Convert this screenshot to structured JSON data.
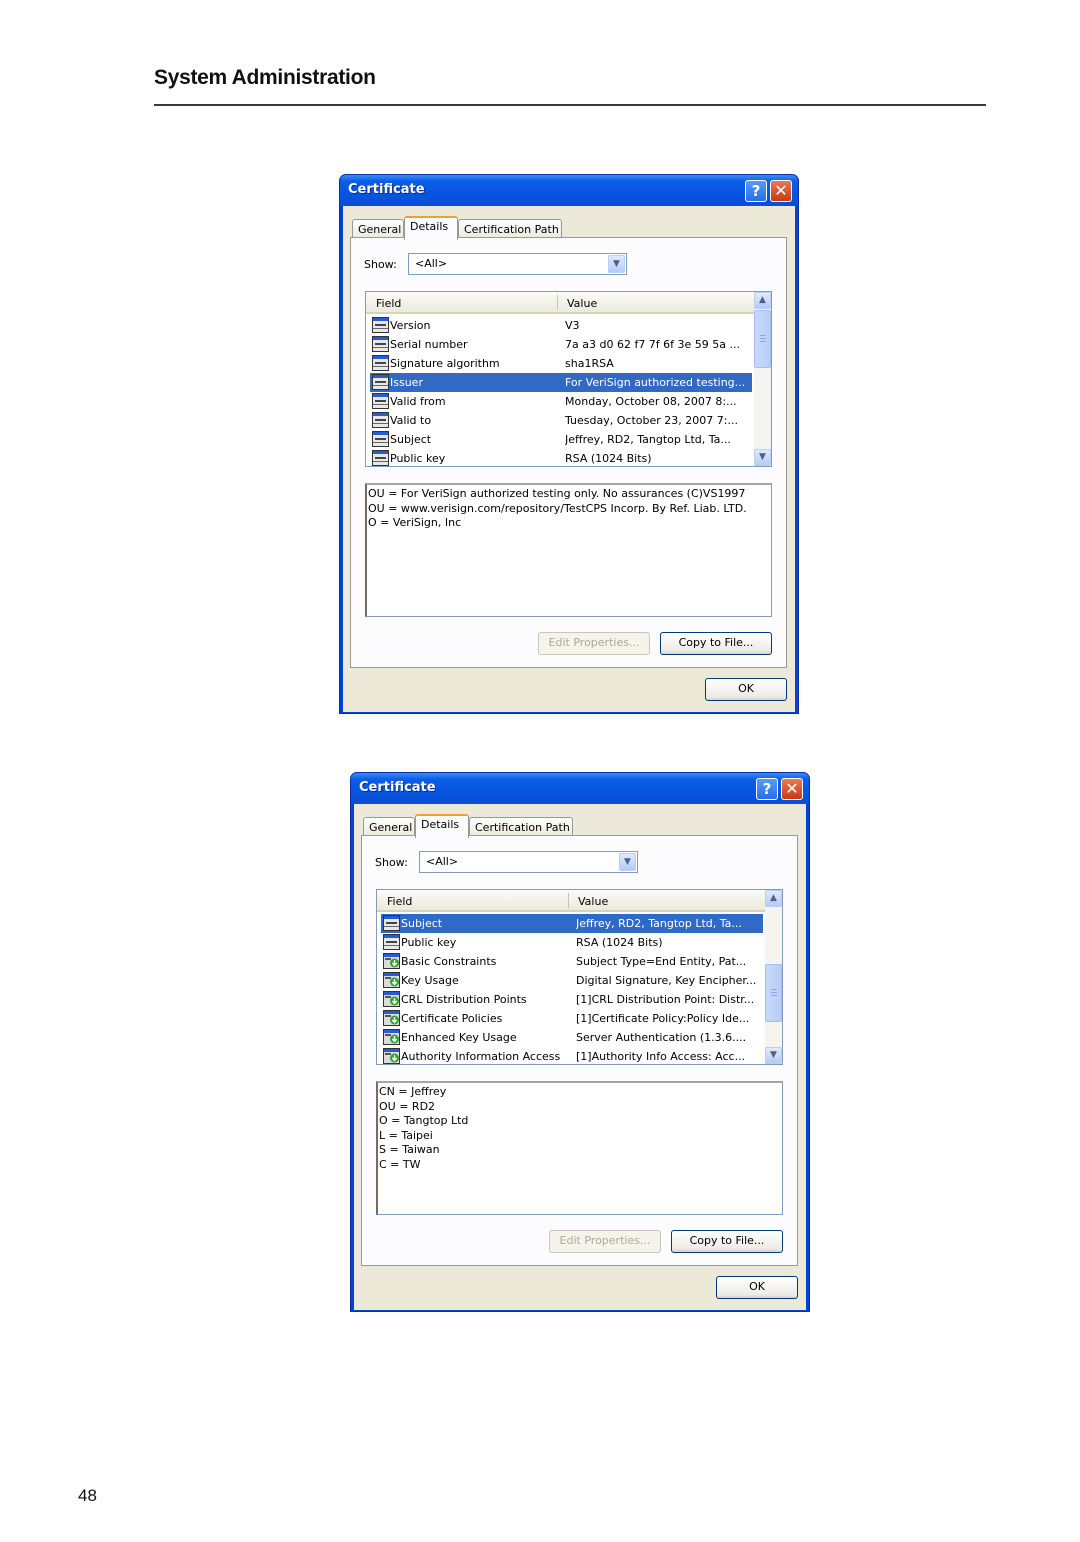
{
  "page": {
    "header": "System Administration",
    "page_number": "48"
  },
  "dialogs": [
    {
      "title": "Certificate",
      "tabs": [
        "General",
        "Details",
        "Certification Path"
      ],
      "active_tab": "Details",
      "show_label": "Show:",
      "show_value": "<All>",
      "columns": [
        "Field",
        "Value"
      ],
      "rows": [
        {
          "icon": "property-icon",
          "field": "Version",
          "value": "V3",
          "selected": false
        },
        {
          "icon": "property-icon",
          "field": "Serial number",
          "value": "7a a3 d0 62 f7 7f 6f 3e 59 5a ...",
          "selected": false
        },
        {
          "icon": "property-icon",
          "field": "Signature algorithm",
          "value": "sha1RSA",
          "selected": false
        },
        {
          "icon": "property-icon",
          "field": "Issuer",
          "value": "For VeriSign authorized testing...",
          "selected": true
        },
        {
          "icon": "property-icon",
          "field": "Valid from",
          "value": "Monday, October 08, 2007 8:...",
          "selected": false
        },
        {
          "icon": "property-icon",
          "field": "Valid to",
          "value": "Tuesday, October 23, 2007 7:...",
          "selected": false
        },
        {
          "icon": "property-icon",
          "field": "Subject",
          "value": "Jeffrey, RD2, Tangtop Ltd, Ta...",
          "selected": false
        },
        {
          "icon": "property-icon",
          "field": "Public key",
          "value": "RSA (1024 Bits)",
          "selected": false
        }
      ],
      "detail_lines": [
        "OU = For VeriSign authorized testing only. No assurances (C)VS1997",
        "OU = www.verisign.com/repository/TestCPS Incorp. By Ref. Liab. LTD.",
        "O = VeriSign, Inc"
      ],
      "buttons": {
        "edit": "Edit Properties...",
        "copy": "Copy to File...",
        "ok": "OK"
      }
    },
    {
      "title": "Certificate",
      "tabs": [
        "General",
        "Details",
        "Certification Path"
      ],
      "active_tab": "Details",
      "show_label": "Show:",
      "show_value": "<All>",
      "columns": [
        "Field",
        "Value"
      ],
      "rows": [
        {
          "icon": "property-icon",
          "field": "Subject",
          "value": "Jeffrey, RD2, Tangtop Ltd, Ta...",
          "selected": true
        },
        {
          "icon": "property-icon",
          "field": "Public key",
          "value": "RSA (1024 Bits)",
          "selected": false
        },
        {
          "icon": "extension-icon",
          "field": "Basic Constraints",
          "value": "Subject Type=End Entity, Pat...",
          "selected": false
        },
        {
          "icon": "extension-icon",
          "field": "Key Usage",
          "value": "Digital Signature, Key Encipher...",
          "selected": false
        },
        {
          "icon": "extension-icon",
          "field": "CRL Distribution Points",
          "value": "[1]CRL Distribution Point: Distr...",
          "selected": false
        },
        {
          "icon": "extension-icon",
          "field": "Certificate Policies",
          "value": "[1]Certificate Policy:Policy Ide...",
          "selected": false
        },
        {
          "icon": "extension-icon",
          "field": "Enhanced Key Usage",
          "value": "Server Authentication (1.3.6....",
          "selected": false
        },
        {
          "icon": "extension-icon",
          "field": "Authority Information Access",
          "value": "[1]Authority Info Access: Acc...",
          "selected": false
        }
      ],
      "detail_lines": [
        "CN = Jeffrey",
        "OU = RD2",
        "O = Tangtop Ltd",
        "L = Taipei",
        "S = Taiwan",
        "C = TW"
      ],
      "buttons": {
        "edit": "Edit Properties...",
        "copy": "Copy to File...",
        "ok": "OK"
      }
    }
  ]
}
